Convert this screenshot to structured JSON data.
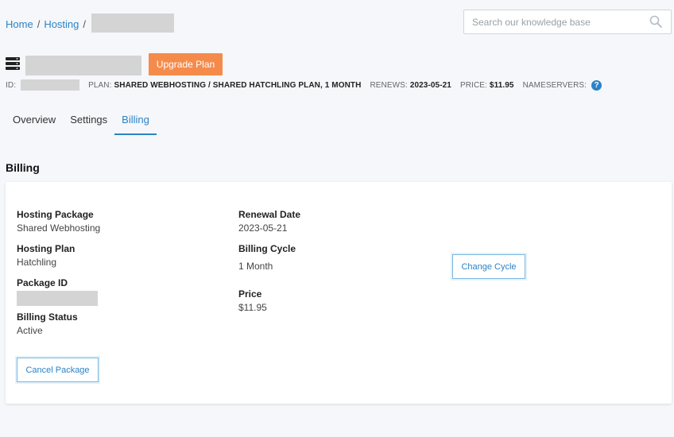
{
  "breadcrumb": {
    "home": "Home",
    "hosting": "Hosting",
    "sep": "/"
  },
  "search": {
    "placeholder": "Search our knowledge base"
  },
  "header": {
    "upgrade_label": "Upgrade Plan"
  },
  "meta": {
    "id_label": "ID:",
    "plan_label": "PLAN:",
    "plan_value": "SHARED WEBHOSTING / SHARED HATCHLING PLAN, 1 MONTH",
    "renews_label": "RENEWS:",
    "renews_value": "2023-05-21",
    "price_label": "PRICE:",
    "price_value": "$11.95",
    "nameservers_label": "NAMESERVERS:",
    "help_glyph": "?"
  },
  "tabs": [
    {
      "label": "Overview"
    },
    {
      "label": "Settings"
    },
    {
      "label": "Billing"
    }
  ],
  "billing": {
    "title": "Billing",
    "hosting_package_label": "Hosting Package",
    "hosting_package_value": "Shared Webhosting",
    "hosting_plan_label": "Hosting Plan",
    "hosting_plan_value": "Hatchling",
    "package_id_label": "Package ID",
    "billing_status_label": "Billing Status",
    "billing_status_value": "Active",
    "renewal_date_label": "Renewal Date",
    "renewal_date_value": "2023-05-21",
    "billing_cycle_label": "Billing Cycle",
    "billing_cycle_value": "1 Month",
    "price_label": "Price",
    "price_value": "$11.95",
    "change_cycle_label": "Change Cycle",
    "cancel_package_label": "Cancel Package"
  },
  "colors": {
    "accent": "#2b83c6",
    "upgrade": "#f58b4b",
    "background": "#f5f7fa"
  }
}
